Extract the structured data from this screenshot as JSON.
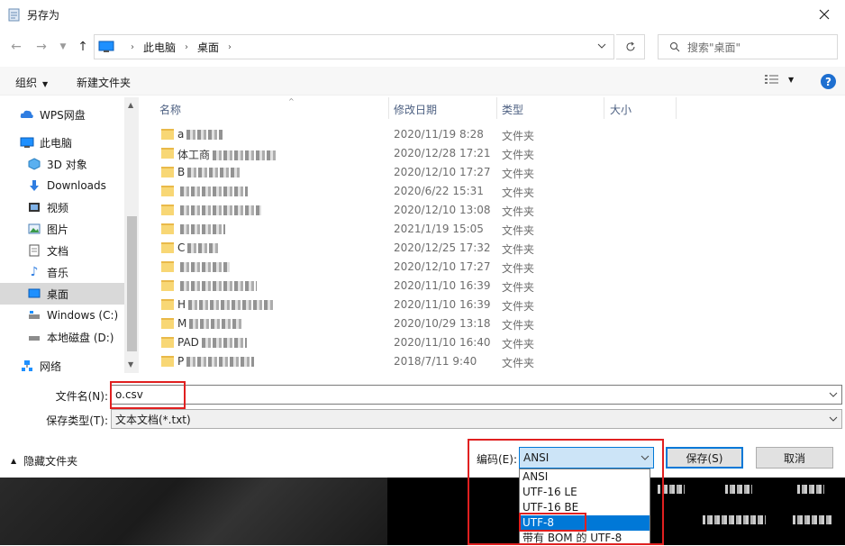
{
  "window": {
    "title": "另存为"
  },
  "address": {
    "crumbs": [
      "此电脑",
      "桌面"
    ],
    "search_placeholder": "搜索\"桌面\""
  },
  "toolbar": {
    "organize": "组织",
    "new_folder": "新建文件夹"
  },
  "sidebar": {
    "items": [
      {
        "label": "WPS网盘",
        "icon": "cloud-icon"
      },
      {
        "label": "此电脑",
        "icon": "computer-icon"
      },
      {
        "label": "3D 对象",
        "icon": "3d-objects-icon"
      },
      {
        "label": "Downloads",
        "icon": "download-icon"
      },
      {
        "label": "视频",
        "icon": "video-icon"
      },
      {
        "label": "图片",
        "icon": "picture-icon"
      },
      {
        "label": "文档",
        "icon": "document-icon"
      },
      {
        "label": "音乐",
        "icon": "music-icon"
      },
      {
        "label": "桌面",
        "icon": "desktop-icon"
      },
      {
        "label": "Windows (C:)",
        "icon": "drive-icon"
      },
      {
        "label": "本地磁盘 (D:)",
        "icon": "drive-icon"
      },
      {
        "label": "网络",
        "icon": "network-icon"
      }
    ]
  },
  "filelist": {
    "columns": {
      "name": "名称",
      "date": "修改日期",
      "type": "类型",
      "size": "大小"
    },
    "rows": [
      {
        "name": "a",
        "date": "2020/11/19 8:28",
        "type": "文件夹"
      },
      {
        "name": "体工商",
        "date": "2020/12/28 17:21",
        "type": "文件夹"
      },
      {
        "name": "B",
        "date": "2020/12/10 17:27",
        "type": "文件夹"
      },
      {
        "name": "",
        "date": "2020/6/22 15:31",
        "type": "文件夹"
      },
      {
        "name": "",
        "date": "2020/12/10 13:08",
        "type": "文件夹"
      },
      {
        "name": "",
        "date": "2021/1/19 15:05",
        "type": "文件夹"
      },
      {
        "name": "C",
        "date": "2020/12/25 17:32",
        "type": "文件夹"
      },
      {
        "name": "",
        "date": "2020/12/10 17:27",
        "type": "文件夹"
      },
      {
        "name": "",
        "date": "2020/11/10 16:39",
        "type": "文件夹"
      },
      {
        "name": "H",
        "date": "2020/11/10 16:39",
        "type": "文件夹"
      },
      {
        "name": "M",
        "date": "2020/10/29 13:18",
        "type": "文件夹"
      },
      {
        "name": "PAD",
        "date": "2020/11/10 16:40",
        "type": "文件夹"
      },
      {
        "name": "P",
        "date": "2018/7/11 9:40",
        "type": "文件夹"
      }
    ]
  },
  "form": {
    "filename_label": "文件名(N):",
    "filename_value": "o.csv",
    "filetype_label": "保存类型(T):",
    "filetype_value": "文本文档(*.txt)"
  },
  "footer": {
    "hide_folders": "隐藏文件夹",
    "encoding_label": "编码(E):",
    "encoding_value": "ANSI",
    "encoding_options": [
      "ANSI",
      "UTF-16 LE",
      "UTF-16 BE",
      "UTF-8",
      "带有 BOM 的 UTF-8"
    ],
    "encoding_selected_index": 3,
    "save_button": "保存(S)",
    "cancel_button": "取消"
  },
  "colors": {
    "accent": "#0078d7",
    "highlight_mark": "#e02020",
    "folder": "#f8d775"
  }
}
